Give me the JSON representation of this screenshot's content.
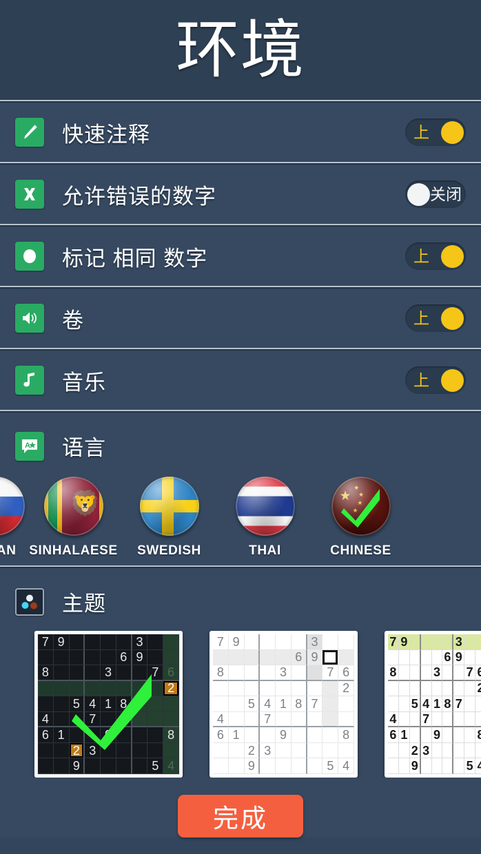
{
  "header": {
    "title": "环境"
  },
  "colors": {
    "background": "#33455c",
    "row_background": "#364961",
    "header_background": "#2e4054",
    "icon_green": "#2aab63",
    "toggle_on": "#f5c518",
    "toggle_off_knob": "#f3f4f6",
    "done_button": "#f4603f",
    "divider": "#b9c2cc"
  },
  "settings": [
    {
      "icon": "pencil-icon",
      "label": "快速注释",
      "toggle": {
        "state": "on",
        "text": "上"
      }
    },
    {
      "icon": "x-mark-icon",
      "label": "允许错误的数字",
      "toggle": {
        "state": "off",
        "text": "关闭"
      }
    },
    {
      "icon": "circle-icon",
      "label": "标记 相同 数字",
      "toggle": {
        "state": "on",
        "text": "上"
      }
    },
    {
      "icon": "speaker-icon",
      "label": "卷",
      "toggle": {
        "state": "on",
        "text": "上"
      }
    },
    {
      "icon": "music-note-icon",
      "label": "音乐",
      "toggle": {
        "state": "on",
        "text": "上"
      }
    }
  ],
  "language": {
    "icon": "translate-icon",
    "label": "语言",
    "items": [
      {
        "label": "SSIAN",
        "full": "RUSSIAN",
        "flag": "russia-flag",
        "selected": false,
        "clipped": true
      },
      {
        "label": "SINHALAESE",
        "full": "SINHALAESE",
        "flag": "srilanka-flag",
        "selected": false,
        "clipped": false
      },
      {
        "label": "SWEDISH",
        "full": "SWEDISH",
        "flag": "sweden-flag",
        "selected": false,
        "clipped": false
      },
      {
        "label": "THAI",
        "full": "THAI",
        "flag": "thai-flag",
        "selected": false,
        "clipped": false
      },
      {
        "label": "CHINESE",
        "full": "CHINESE",
        "flag": "china-flag",
        "selected": true,
        "clipped": false
      }
    ]
  },
  "theme": {
    "icon": "theme-palette-icon",
    "label": "主题",
    "items": [
      {
        "name": "dark-theme",
        "selected": true,
        "clipped": false
      },
      {
        "name": "light-theme",
        "selected": false,
        "clipped": false
      },
      {
        "name": "white-theme",
        "selected": false,
        "clipped": true
      }
    ],
    "board_preview": {
      "rows": [
        [
          "7",
          "9",
          "",
          "",
          "",
          "",
          "3",
          "",
          ""
        ],
        [
          "",
          "",
          "",
          "",
          "",
          "6",
          "9",
          "",
          ""
        ],
        [
          "8",
          "",
          "",
          "",
          "3",
          "",
          "",
          "7",
          "6"
        ],
        [
          "",
          "",
          "",
          "",
          "",
          "",
          "",
          "",
          "2"
        ],
        [
          "",
          "",
          "5",
          "4",
          "1",
          "8",
          "7",
          "",
          ""
        ],
        [
          "4",
          "",
          "",
          "7",
          "",
          "",
          "",
          "",
          ""
        ],
        [
          "6",
          "1",
          "",
          "",
          "9",
          "",
          "",
          "",
          "8"
        ],
        [
          "",
          "",
          "2",
          "3",
          "",
          "",
          "",
          "",
          ""
        ],
        [
          "",
          "",
          "9",
          "",
          "",
          "",
          "",
          "5",
          "4"
        ]
      ],
      "highlight_row_index": 3,
      "highlight_col_index": 8,
      "selected_cell": {
        "row": 3,
        "col": 8,
        "value": "2"
      },
      "secondary_marked_cell": {
        "row": 7,
        "col": 2,
        "value": "2"
      },
      "light_selected_cell": {
        "row": 1,
        "col": 7
      }
    }
  },
  "footer": {
    "done_label": "完成"
  }
}
